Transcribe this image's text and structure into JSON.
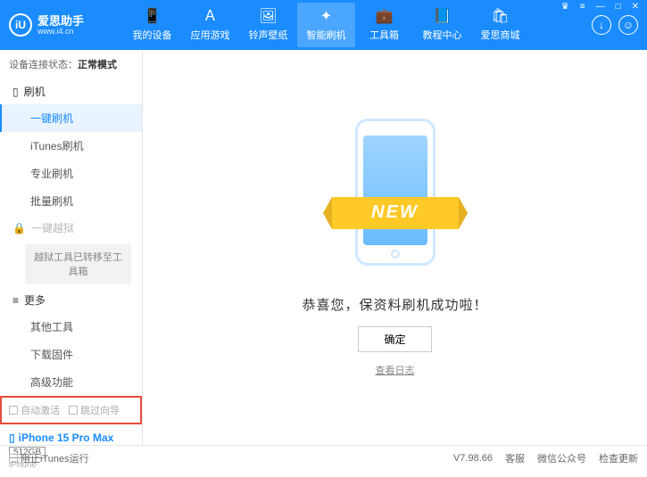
{
  "header": {
    "logo_text": "爱思助手",
    "logo_sub": "www.i4.cn",
    "logo_short": "iU",
    "nav": [
      {
        "label": "我的设备",
        "icon": "📱"
      },
      {
        "label": "应用游戏",
        "icon": "Ａ"
      },
      {
        "label": "铃声壁纸",
        "icon": "🖼"
      },
      {
        "label": "智能刷机",
        "icon": "✦",
        "active": true
      },
      {
        "label": "工具箱",
        "icon": "💼"
      },
      {
        "label": "教程中心",
        "icon": "📘"
      },
      {
        "label": "爱思商城",
        "icon": "🛍"
      }
    ],
    "win": {
      "gift": "♛",
      "menu": "≡",
      "min": "—",
      "max": "□",
      "close": "✕"
    }
  },
  "sidebar": {
    "status_label": "设备连接状态：",
    "status_value": "正常模式",
    "group_flash": "刷机",
    "items_flash": [
      "一键刷机",
      "iTunes刷机",
      "专业刷机",
      "批量刷机"
    ],
    "group_jailbreak": "一键越狱",
    "jailbreak_note": "越狱工具已转移至工具箱",
    "group_more": "更多",
    "items_more": [
      "其他工具",
      "下载固件",
      "高级功能"
    ],
    "cb_auto_activate": "自动激活",
    "cb_skip_guide": "跳过向导",
    "device_name": "iPhone 15 Pro Max",
    "device_capacity": "512GB",
    "device_type": "iPhone"
  },
  "main": {
    "ribbon": "NEW",
    "success": "恭喜您，保资料刷机成功啦！",
    "ok": "确定",
    "log_link": "查看日志"
  },
  "footer": {
    "block_itunes": "阻止iTunes运行",
    "version": "V7.98.66",
    "links": [
      "客服",
      "微信公众号",
      "检查更新"
    ]
  }
}
